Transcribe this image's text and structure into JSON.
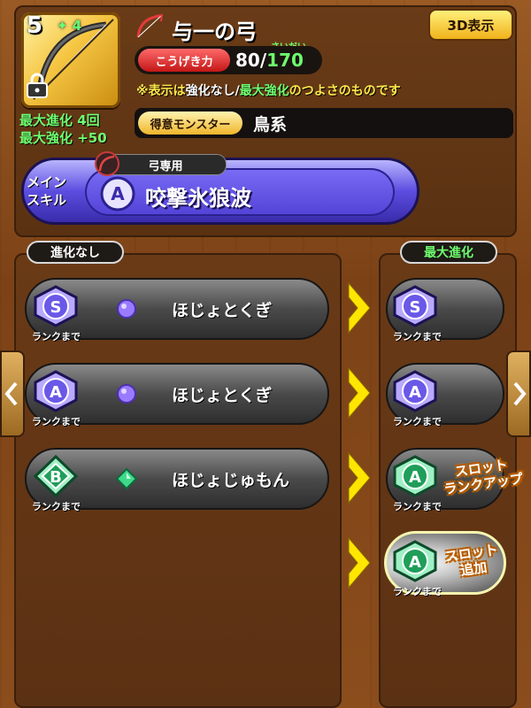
{
  "weapon": {
    "rank": "5",
    "star_count": "4",
    "name": "与一の弓",
    "max_evolution": "最大進化 4回",
    "max_enhance": "最大強化 +50"
  },
  "header": {
    "view_3d_label": "3D表示"
  },
  "stats": {
    "attack_label": "こうげき力",
    "attack_value": "80",
    "attack_sep": "/",
    "attack_max": "170",
    "attack_max_furigana": "さいだい"
  },
  "note": {
    "part1": "※表示は",
    "part2": "強化なし",
    "part3": "/",
    "part4": "最大強化",
    "part5": "のつよさのものです"
  },
  "monster": {
    "label": "得意モンスター",
    "value": "鳥系"
  },
  "main_skill": {
    "label_line1": "メイン",
    "label_line2": "スキル",
    "restriction": "弓専用",
    "rank": "A",
    "name": "咬撃氷狼波"
  },
  "left_panel": {
    "title": "進化なし",
    "slots": [
      {
        "rank": "S",
        "rank_note": "ランクまで",
        "name": "ほじょとくぎ",
        "gem_color": "#9a7bff"
      },
      {
        "rank": "A",
        "rank_note": "ランクまで",
        "name": "ほじょとくぎ",
        "gem_color": "#9a7bff"
      },
      {
        "rank": "B",
        "rank_note": "ランクまで",
        "name": "ほじょじゅもん",
        "gem_color": "#3fd98a"
      }
    ]
  },
  "right_panel": {
    "title": "最大進化",
    "slots": [
      {
        "rank": "S",
        "rank_note": "ランクまで"
      },
      {
        "rank": "A",
        "rank_note": "ランクまで"
      },
      {
        "rank": "A",
        "rank_note": "ランクまで",
        "badge_line1": "スロット",
        "badge_line2": "ランクアップ"
      },
      {
        "rank": "A",
        "rank_note": "ランクまで",
        "badge_line1": "スロット",
        "badge_line2": "追加"
      }
    ]
  },
  "colors": {
    "wood": "#8b4d1c",
    "accent_gold": "#f0b21a",
    "green_text": "#6dff6d",
    "skill_purple": "#5c4de0"
  }
}
